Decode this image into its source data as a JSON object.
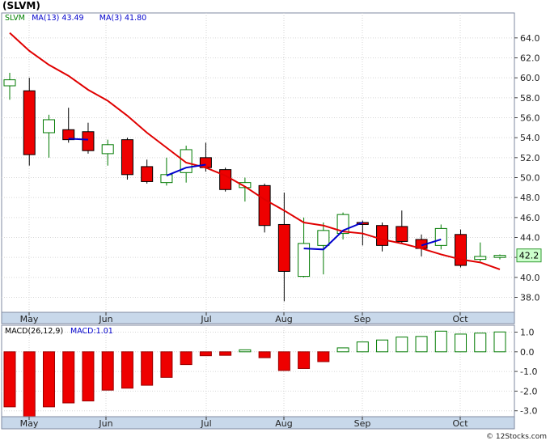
{
  "page_title": "(SLVM)",
  "credit": "© 12Stocks.com",
  "chart_data": [
    {
      "type": "candlestick",
      "legend": [
        {
          "label": "SLVM",
          "color": "#008000"
        },
        {
          "label": "MA(13)",
          "value": "43.49",
          "color": "#0000cc"
        },
        {
          "label": "MA(3)",
          "value": "41.80",
          "color": "#0000cc"
        }
      ],
      "x_ticks": [
        "May",
        "Jun",
        "Jul",
        "Aug",
        "Sep",
        "Oct"
      ],
      "y_ticks": [
        "38.0",
        "40.0",
        "42.0",
        "44.0",
        "46.0",
        "48.0",
        "50.0",
        "52.0",
        "54.0",
        "56.0",
        "58.0",
        "60.0",
        "62.0",
        "64.0"
      ],
      "ylim": [
        36.5,
        66.5
      ],
      "grid": true,
      "last_price": "42.2",
      "candles": [
        {
          "o": 59.2,
          "h": 60.5,
          "l": 57.8,
          "c": 59.8
        },
        {
          "o": 58.7,
          "h": 60.0,
          "l": 51.2,
          "c": 52.3
        },
        {
          "o": 54.5,
          "h": 56.3,
          "l": 52.0,
          "c": 55.8
        },
        {
          "o": 54.8,
          "h": 57.0,
          "l": 53.5,
          "c": 53.8
        },
        {
          "o": 54.6,
          "h": 55.5,
          "l": 52.4,
          "c": 52.7
        },
        {
          "o": 52.4,
          "h": 53.8,
          "l": 51.2,
          "c": 53.3
        },
        {
          "o": 53.8,
          "h": 54.0,
          "l": 49.8,
          "c": 50.3
        },
        {
          "o": 51.1,
          "h": 51.8,
          "l": 49.4,
          "c": 49.6
        },
        {
          "o": 49.5,
          "h": 52.0,
          "l": 49.2,
          "c": 50.3
        },
        {
          "o": 50.5,
          "h": 53.2,
          "l": 49.5,
          "c": 52.8
        },
        {
          "o": 52.0,
          "h": 53.5,
          "l": 50.6,
          "c": 51.0
        },
        {
          "o": 50.8,
          "h": 51.0,
          "l": 48.6,
          "c": 48.8
        },
        {
          "o": 49.0,
          "h": 50.0,
          "l": 47.6,
          "c": 49.5
        },
        {
          "o": 49.2,
          "h": 49.4,
          "l": 44.5,
          "c": 45.2
        },
        {
          "o": 45.3,
          "h": 48.5,
          "l": 37.6,
          "c": 40.6
        },
        {
          "o": 40.1,
          "h": 46.0,
          "l": 40.0,
          "c": 43.4
        },
        {
          "o": 43.2,
          "h": 45.5,
          "l": 40.3,
          "c": 44.7
        },
        {
          "o": 44.4,
          "h": 46.5,
          "l": 43.8,
          "c": 46.3
        },
        {
          "o": 45.5,
          "h": 45.7,
          "l": 43.2,
          "c": 45.3
        },
        {
          "o": 45.2,
          "h": 45.5,
          "l": 42.6,
          "c": 43.2
        },
        {
          "o": 45.1,
          "h": 46.7,
          "l": 43.4,
          "c": 43.6
        },
        {
          "o": 43.8,
          "h": 44.3,
          "l": 42.1,
          "c": 42.9
        },
        {
          "o": 43.2,
          "h": 45.3,
          "l": 42.8,
          "c": 44.9
        },
        {
          "o": 44.3,
          "h": 44.8,
          "l": 41.0,
          "c": 41.2
        },
        {
          "o": 41.8,
          "h": 43.5,
          "l": 41.6,
          "c": 42.1
        },
        {
          "o": 42.0,
          "h": 42.3,
          "l": 41.8,
          "c": 42.2
        }
      ],
      "ma_red": [
        64.5,
        62.7,
        61.3,
        60.2,
        58.8,
        57.7,
        56.2,
        54.5,
        53.0,
        51.5,
        51.0,
        50.2,
        49.1,
        47.8,
        46.7,
        45.5,
        45.2,
        44.6,
        44.4,
        43.8,
        43.4,
        42.9,
        42.3,
        41.8,
        41.5,
        40.8
      ],
      "ma_blue": [
        null,
        null,
        null,
        53.9,
        53.8,
        null,
        null,
        null,
        50.2,
        51.0,
        51.3,
        null,
        null,
        null,
        null,
        42.9,
        42.8,
        44.7,
        45.5,
        null,
        null,
        43.2,
        43.8,
        null,
        null,
        null
      ]
    },
    {
      "type": "bar",
      "title": "MACD(26,12,9)",
      "value_label": "MACD:1.01",
      "y_ticks": [
        "-3.0",
        "-2.0",
        "-1.0",
        "0.0",
        "1.0"
      ],
      "ylim": [
        -3.3,
        1.35
      ],
      "grid": true,
      "x_ticks": [
        "May",
        "Jun",
        "Jul",
        "Aug",
        "Sep",
        "Oct"
      ],
      "values": [
        -2.8,
        -3.3,
        -2.8,
        -2.6,
        -2.5,
        -1.95,
        -1.85,
        -1.7,
        -1.3,
        -0.65,
        -0.2,
        -0.18,
        0.1,
        -0.3,
        -0.95,
        -0.85,
        -0.5,
        0.2,
        0.5,
        0.6,
        0.75,
        0.78,
        1.05,
        0.9,
        0.95,
        1.01
      ]
    }
  ]
}
